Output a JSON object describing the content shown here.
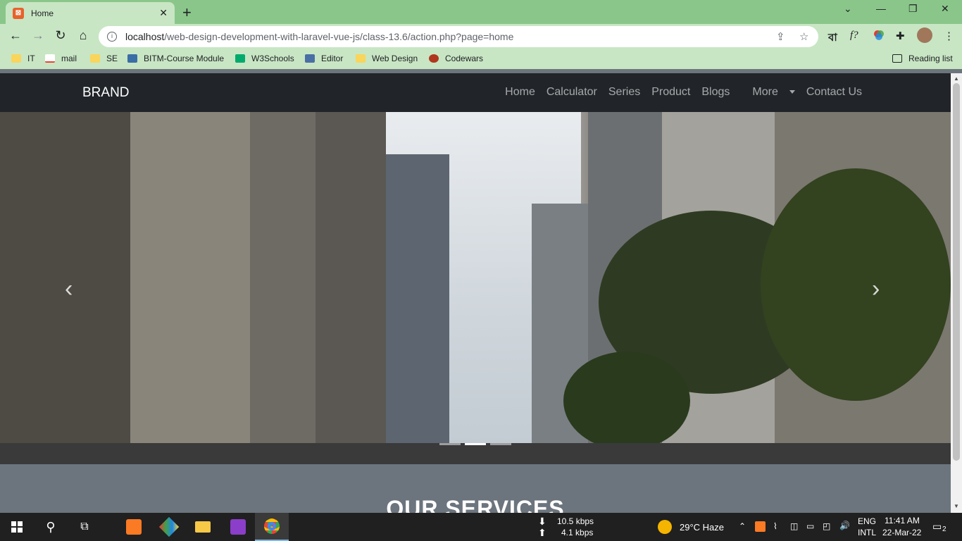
{
  "browser": {
    "tab_title": "Home",
    "url_host": "localhost",
    "url_path": "/web-design-development-with-laravel-vue-js/class-13.6/action.php?page=home",
    "reading_list": "Reading list",
    "ext_bn": "বা",
    "ext_f": "f?"
  },
  "bookmarks": [
    {
      "label": "IT",
      "icon": "folder-icon"
    },
    {
      "label": "mail",
      "icon": "gmail-icon"
    },
    {
      "label": "SE",
      "icon": "folder-icon"
    },
    {
      "label": "BITM-Course Module",
      "icon": "bitm-icon"
    },
    {
      "label": "W3Schools",
      "icon": "w3schools-icon"
    },
    {
      "label": "Editor",
      "icon": "editor-icon"
    },
    {
      "label": "Web Design",
      "icon": "folder-icon"
    },
    {
      "label": "Codewars",
      "icon": "codewars-icon"
    }
  ],
  "site": {
    "brand": "BRAND",
    "nav": [
      "Home",
      "Calculator",
      "Series",
      "Product",
      "Blogs",
      "More",
      "Contact Us"
    ],
    "section_title": "OUR SERVICES",
    "carousel_slide_count": 3,
    "carousel_active_index": 1
  },
  "taskbar": {
    "net_down": "10.5 kbps",
    "net_up": "4.1 kbps",
    "weather": "29°C  Haze",
    "lang_top": "ENG",
    "lang_bottom": "INTL",
    "time": "11:41 AM",
    "date": "22-Mar-22",
    "notifications": "2"
  },
  "colors": {
    "tabstrip": "#8ac68a",
    "toolbar": "#c8e6c4",
    "navbar": "#212529",
    "page_bg": "#6c757d"
  }
}
